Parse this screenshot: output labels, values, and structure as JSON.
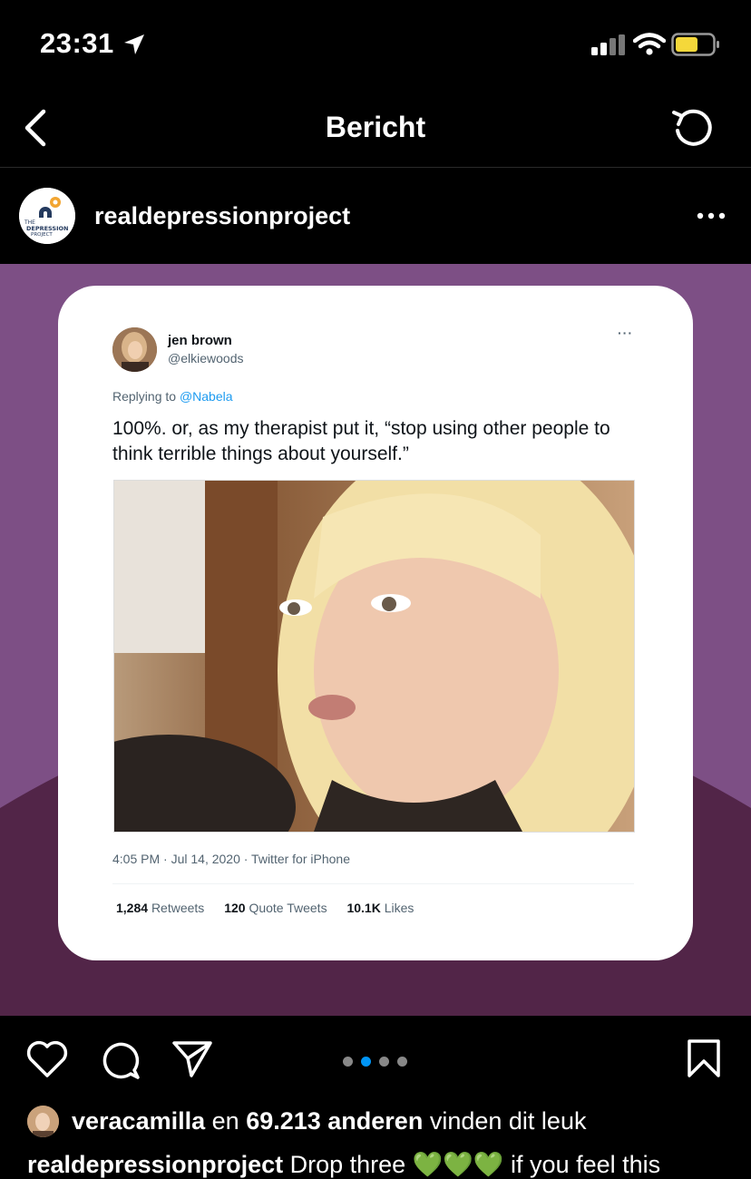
{
  "status": {
    "time": "23:31"
  },
  "nav": {
    "title": "Bericht"
  },
  "post": {
    "username": "realdepressionproject",
    "avatar_text": [
      "THE",
      "DEPRESSION",
      "PROJECT"
    ]
  },
  "tweet": {
    "name": "jen brown",
    "handle": "@elkiewoods",
    "more": "···",
    "replying_prefix": "Replying to",
    "replying_to": "@Nabela",
    "text": "100%. or, as my therapist put it, “stop using other people to think terrible things about yourself.”",
    "meta": "4:05 PM · Jul 14, 2020 · Twitter for iPhone",
    "stats": [
      {
        "value": "1,284",
        "label": "Retweets"
      },
      {
        "value": "120",
        "label": "Quote Tweets"
      },
      {
        "value": "10.1K",
        "label": "Likes"
      }
    ]
  },
  "carousel": {
    "count": 4,
    "active": 2
  },
  "likes": {
    "user": "veracamilla",
    "mid": "en",
    "count": "69.213 anderen",
    "suffix": "vinden dit leuk"
  },
  "caption": {
    "user": "realdepressionproject",
    "text": "Drop three 💚💚💚 if you feel this"
  },
  "colors": {
    "media_bg": "#7d4f85",
    "media_wave": "#522548",
    "link": "#1d9bf0",
    "active_dot": "#0095f6"
  }
}
